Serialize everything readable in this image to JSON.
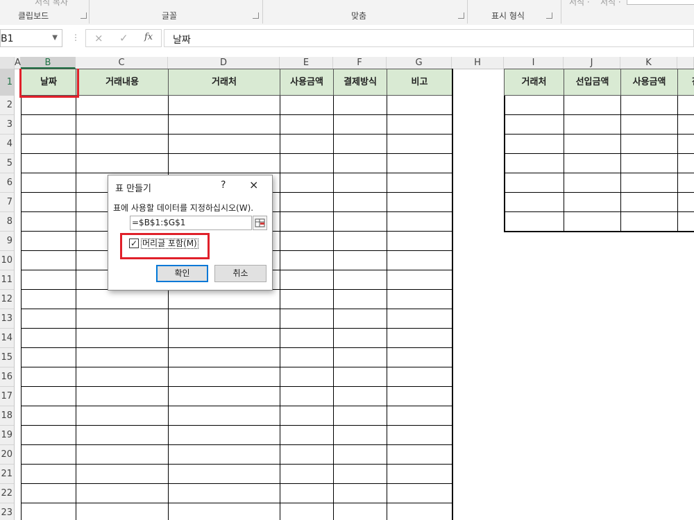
{
  "ribbon": {
    "top_partial": [
      "서식 복사",
      "서식 ·",
      "서식 ·"
    ],
    "groups": [
      "클립보드",
      "글꼴",
      "맞춤",
      "표시 형식"
    ]
  },
  "formula_bar": {
    "name_box": "B1",
    "cancel_glyph": "×",
    "enter_glyph": "✓",
    "fx_glyph": "fx",
    "content": "날짜"
  },
  "columns": [
    "A",
    "B",
    "C",
    "D",
    "E",
    "F",
    "G",
    "H",
    "I",
    "J",
    "K"
  ],
  "rows": [
    "1",
    "2",
    "3",
    "4",
    "5",
    "6",
    "7",
    "8",
    "9",
    "10",
    "11",
    "12",
    "13",
    "14",
    "15",
    "16",
    "17",
    "18",
    "19",
    "20",
    "21",
    "22",
    "23"
  ],
  "table1_headers": [
    "날짜",
    "거래내용",
    "거래처",
    "사용금액",
    "결제방식",
    "비고"
  ],
  "table2_headers": [
    "거래처",
    "선입금액",
    "사용금액"
  ],
  "table2_partial_header": "잔",
  "dialog": {
    "title": "표 만들기",
    "help": "?",
    "close": "×",
    "prompt": "표에 사용할 데이터를 지정하십시오(W).",
    "range": "=$B$1:$G$1",
    "checkbox_label": "머리글 포함(M)",
    "checkbox_checked": "✓",
    "ok": "확인",
    "cancel": "취소"
  },
  "colors": {
    "header_fill": "#d9ead3",
    "highlight": "#e0202a",
    "excel_green": "#217346"
  }
}
